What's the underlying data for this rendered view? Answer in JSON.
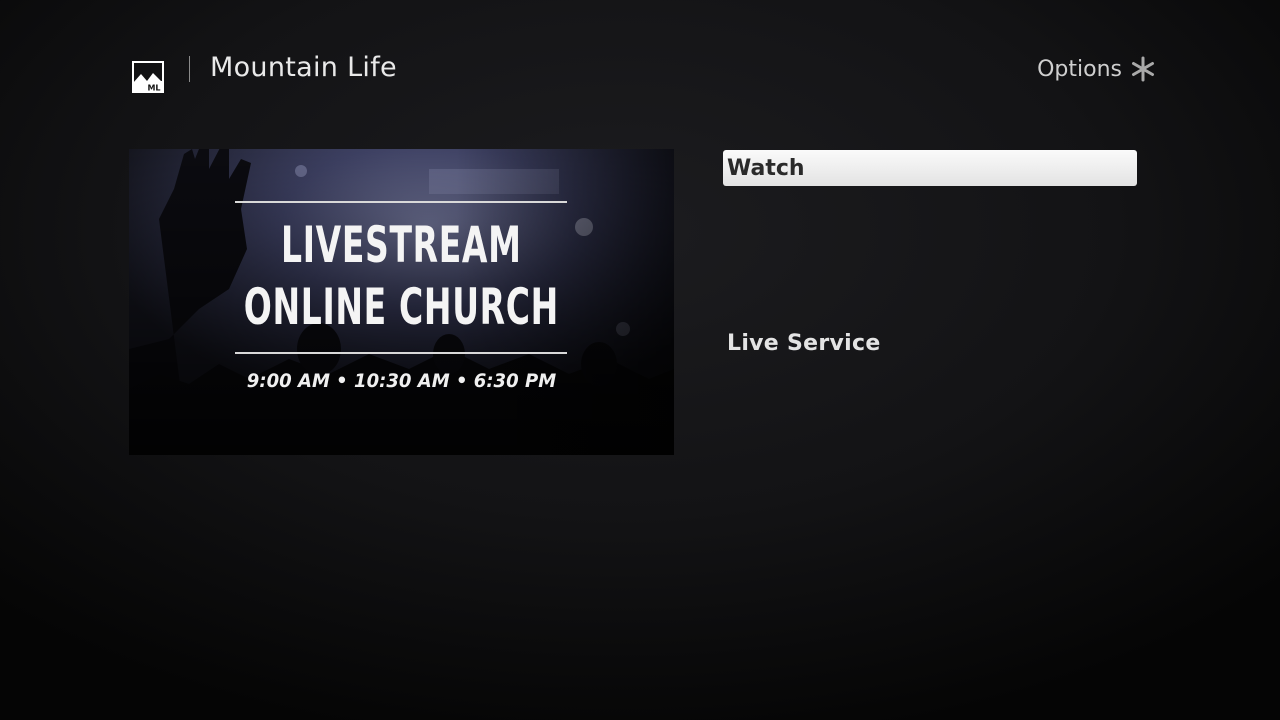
{
  "header": {
    "logo_icon": "mountain-life-logo-icon",
    "logo_text": "ML",
    "channel_title": "Mountain Life",
    "options_label": "Options",
    "options_icon": "asterisk-icon"
  },
  "poster": {
    "line1": "LIVESTREAM",
    "line2": "ONLINE CHURCH",
    "times": "9:00 AM  •  10:30 AM  •  6:30 PM"
  },
  "actions": {
    "watch_label": "Watch"
  },
  "item": {
    "title": "Live Service"
  },
  "colors": {
    "background": "#131315",
    "button_bg": "#f0f0f0",
    "button_text": "#2a2a2a",
    "text": "#e6e6e6"
  }
}
